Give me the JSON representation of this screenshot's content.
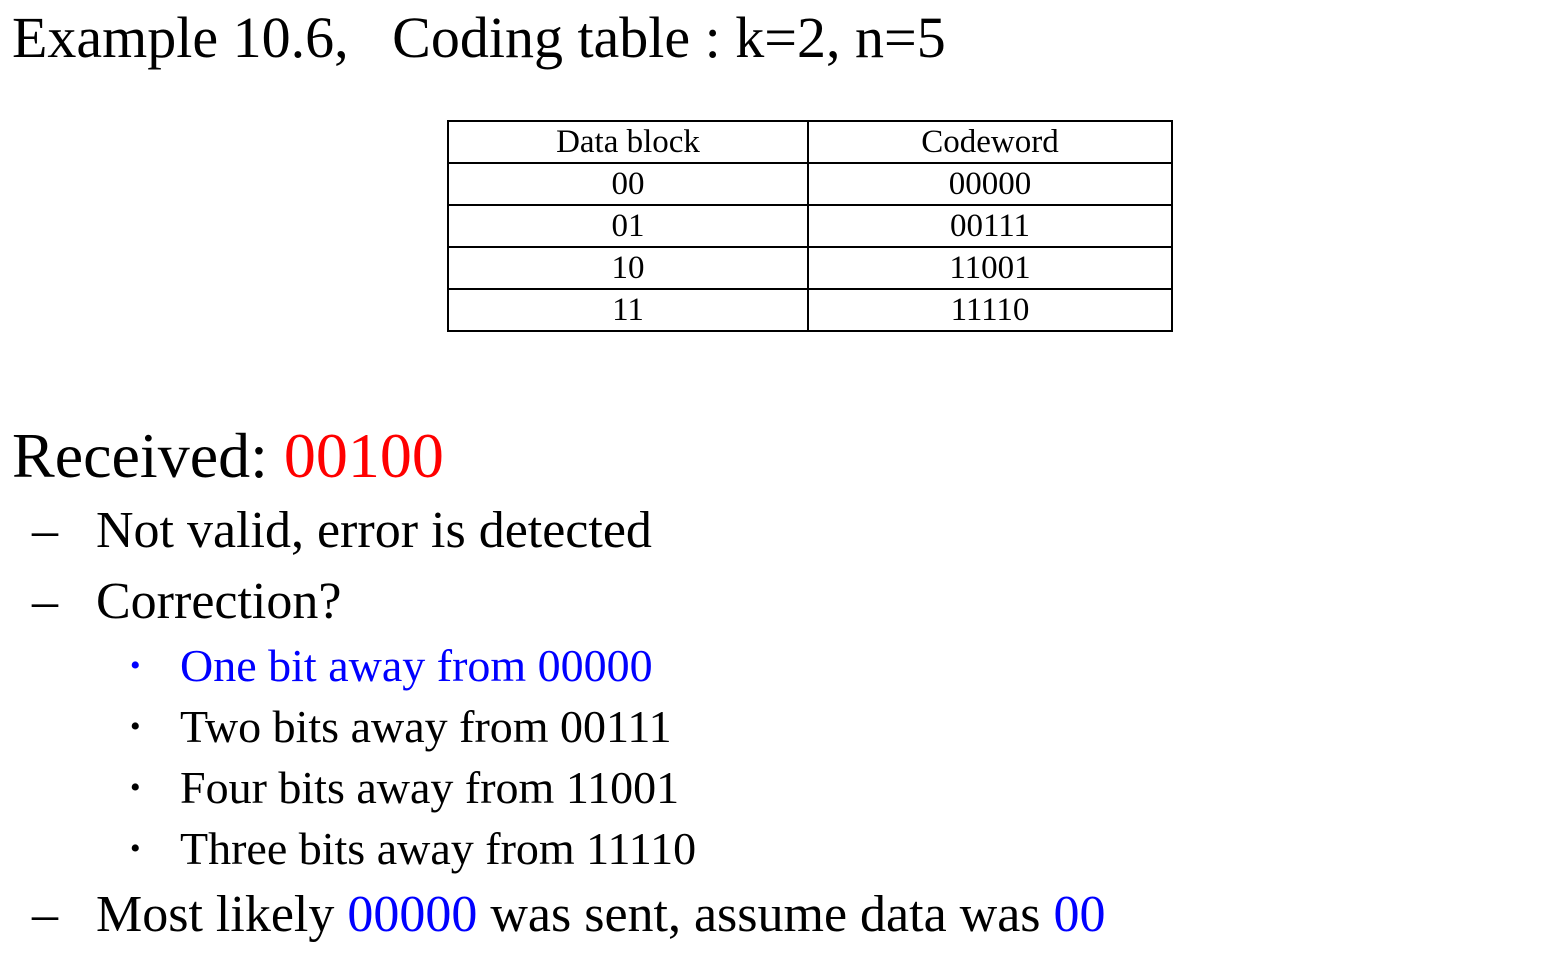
{
  "title": "Example 10.6,   Coding table : k=2, n=5",
  "table": {
    "headers": [
      "Data block",
      "Codeword"
    ],
    "rows": [
      [
        "00",
        "00000"
      ],
      [
        "01",
        "00111"
      ],
      [
        "10",
        "11001"
      ],
      [
        "11",
        "11110"
      ]
    ]
  },
  "received": {
    "label": "Received: ",
    "value": "00100",
    "value_color": "#ff0000"
  },
  "points": {
    "dash": "–",
    "bullet": "•",
    "not_valid": "Not valid, error is detected",
    "correction": "Correction?",
    "sub": [
      {
        "text": "One bit away from 00000",
        "color": "#0000ff"
      },
      {
        "text": "Two bits away from 00111",
        "color": "#000000"
      },
      {
        "text": "Four bits away from 11001",
        "color": "#000000"
      },
      {
        "text": "Three bits away from 11110",
        "color": "#000000"
      }
    ],
    "conclusion": {
      "part1": "Most likely ",
      "codeword": "00000",
      "part2": " was sent, assume data was ",
      "data": "00",
      "highlight_color": "#0000ff"
    }
  }
}
